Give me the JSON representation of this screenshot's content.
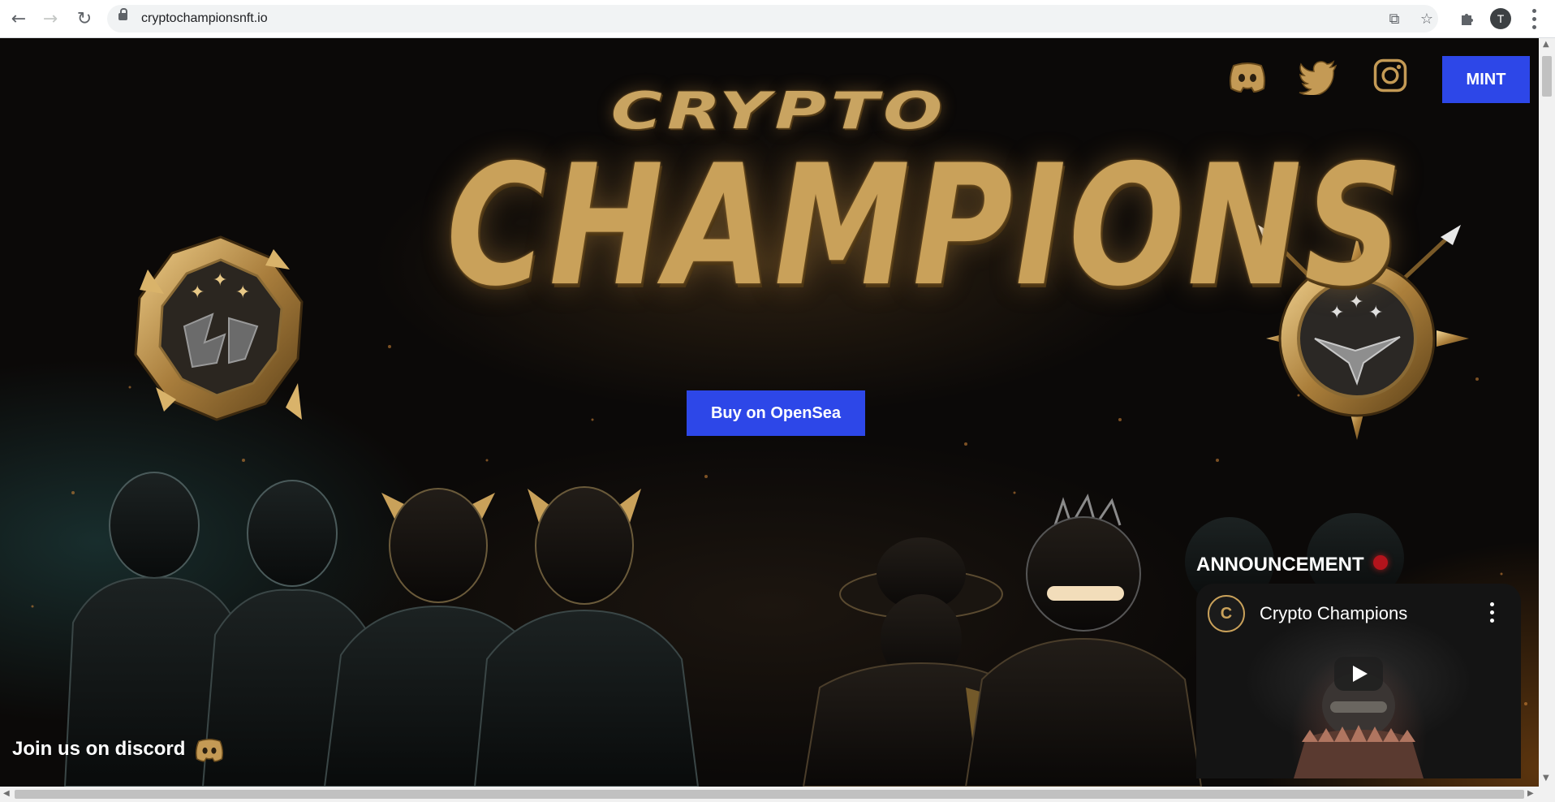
{
  "browser": {
    "url": "cryptochampionsnft.io",
    "avatar_initial": "T",
    "icons": [
      "back-arrow-icon",
      "forward-arrow-icon",
      "reload-icon",
      "lock-icon",
      "share-icon",
      "star-icon",
      "extensions-puzzle-icon",
      "kebab-menu-icon"
    ]
  },
  "header": {
    "social_icons": [
      "discord-icon",
      "twitter-icon",
      "instagram-icon"
    ],
    "mint_label": "MINT"
  },
  "hero": {
    "logo_line1": "CRYPTO",
    "logo_line2": "CHAMPIONS",
    "buy_label": "Buy on OpenSea"
  },
  "discord_cta": {
    "label": "Join us on discord"
  },
  "announcement": {
    "heading": "ANNOUNCEMENT",
    "video_channel": "Crypto Champions"
  },
  "colors": {
    "button_blue": "#2d47e8",
    "gold": "#c9a15a",
    "background": "#0b0908",
    "live_dot": "#b3141c"
  }
}
